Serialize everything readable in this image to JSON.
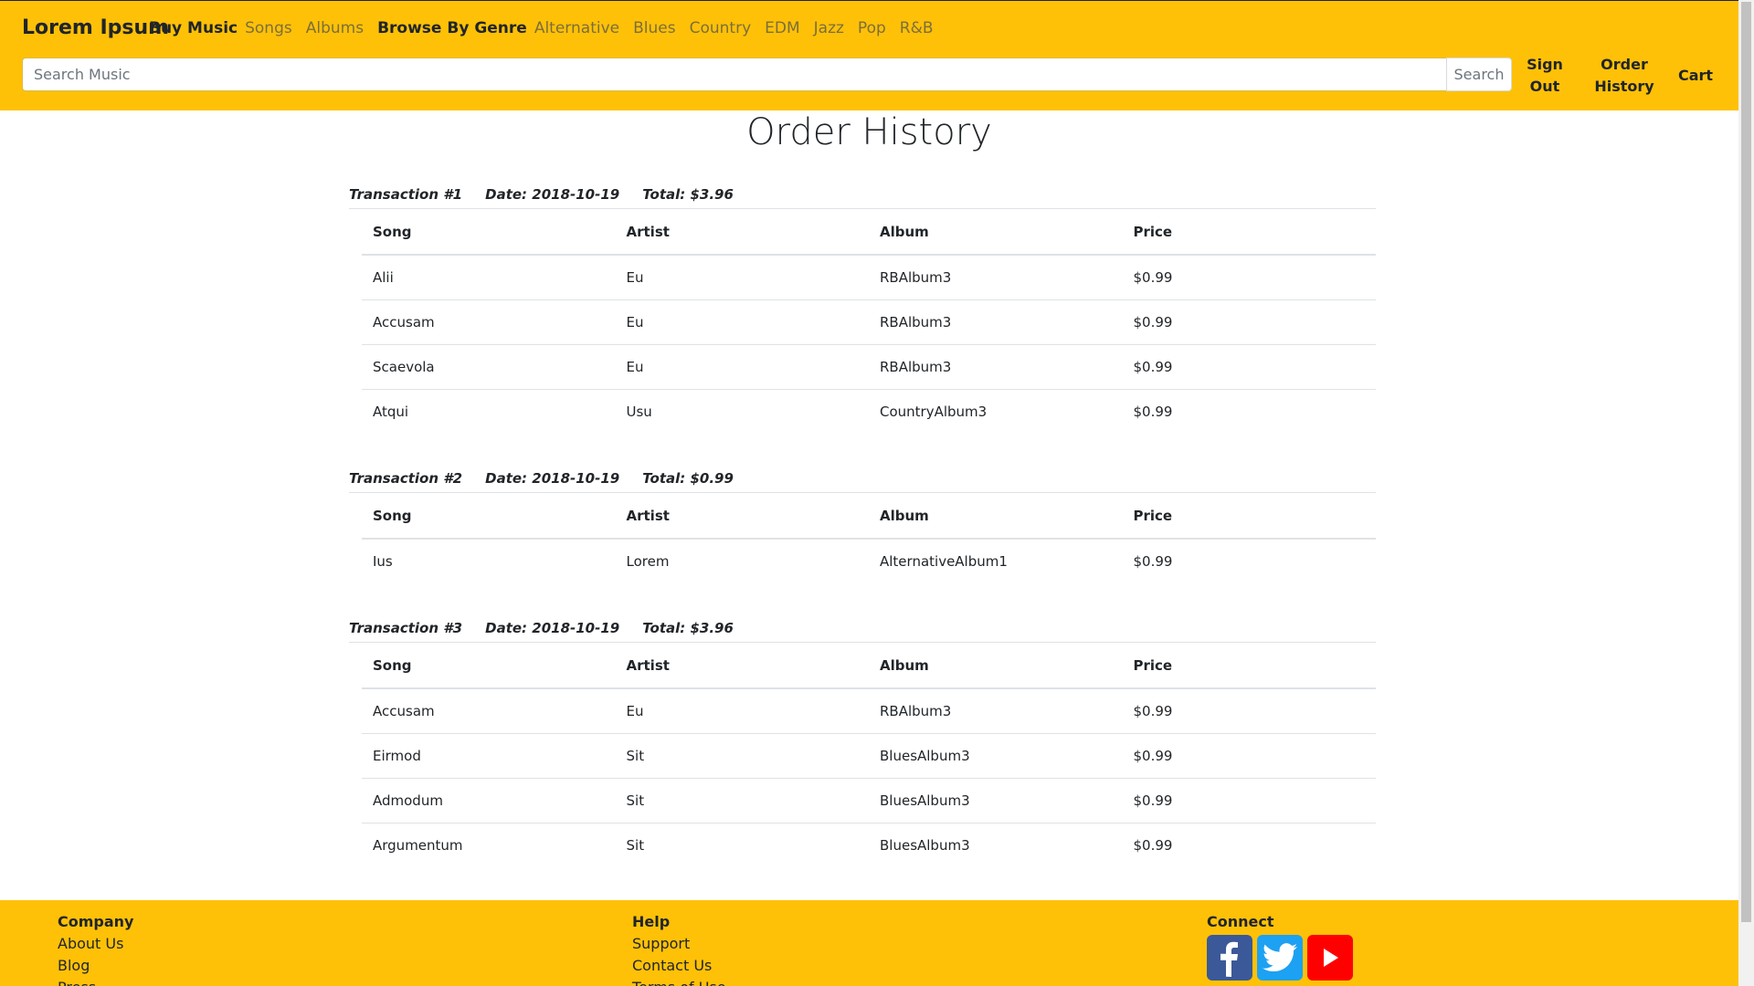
{
  "brand": "Lorem Ipsum",
  "nav": {
    "buy_music": "Buy Music",
    "songs": "Songs",
    "albums": "Albums",
    "browse_by_genre": "Browse By Genre",
    "genres": [
      "Alternative",
      "Blues",
      "Country",
      "EDM",
      "Jazz",
      "Pop",
      "R&B"
    ],
    "sign_out": [
      "Sign",
      "Out"
    ],
    "order_history": [
      "Order",
      "History"
    ],
    "cart": "Cart"
  },
  "search": {
    "placeholder": "Search Music",
    "button": "Search"
  },
  "page_title": "Order History",
  "columns": [
    "Song",
    "Artist",
    "Album",
    "Price"
  ],
  "transactions": [
    {
      "label": "Transaction #1",
      "date": "Date: 2018-10-19",
      "total": "Total: $3.96",
      "rows": [
        [
          "Alii",
          "Eu",
          "RBAlbum3",
          "$0.99"
        ],
        [
          "Accusam",
          "Eu",
          "RBAlbum3",
          "$0.99"
        ],
        [
          "Scaevola",
          "Eu",
          "RBAlbum3",
          "$0.99"
        ],
        [
          "Atqui",
          "Usu",
          "CountryAlbum3",
          "$0.99"
        ]
      ]
    },
    {
      "label": "Transaction #2",
      "date": "Date: 2018-10-19",
      "total": "Total: $0.99",
      "rows": [
        [
          "Ius",
          "Lorem",
          "AlternativeAlbum1",
          "$0.99"
        ]
      ]
    },
    {
      "label": "Transaction #3",
      "date": "Date: 2018-10-19",
      "total": "Total: $3.96",
      "rows": [
        [
          "Accusam",
          "Eu",
          "RBAlbum3",
          "$0.99"
        ],
        [
          "Eirmod",
          "Sit",
          "BluesAlbum3",
          "$0.99"
        ],
        [
          "Admodum",
          "Sit",
          "BluesAlbum3",
          "$0.99"
        ],
        [
          "Argumentum",
          "Sit",
          "BluesAlbum3",
          "$0.99"
        ]
      ]
    }
  ],
  "footer": {
    "company": {
      "heading": "Company",
      "links": [
        "About Us",
        "Blog",
        "Press"
      ]
    },
    "help": {
      "heading": "Help",
      "links": [
        "Support",
        "Contact Us",
        "Terms of Use"
      ]
    },
    "connect": {
      "heading": "Connect",
      "icons": [
        "facebook-icon",
        "twitter-icon",
        "youtube-icon"
      ]
    }
  },
  "colors": {
    "accent": "#ffc107",
    "facebook": "#3b5998",
    "twitter": "#1da1f2",
    "youtube": "#ff0000"
  }
}
